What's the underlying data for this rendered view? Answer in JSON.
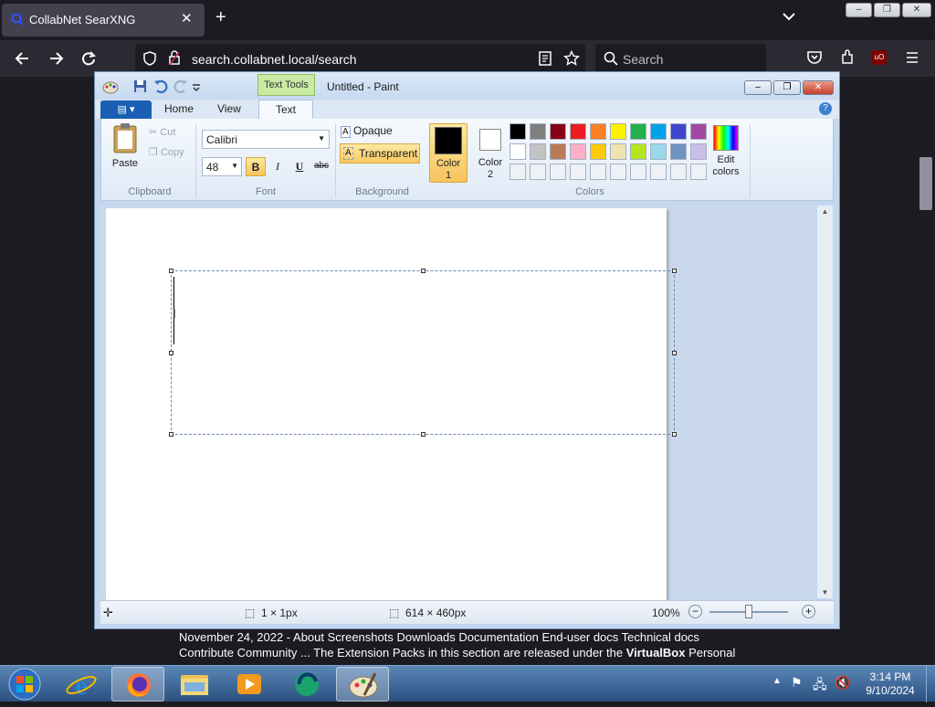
{
  "browser": {
    "tab_title": "CollabNet SearXNG",
    "url": "search.collabnet.local/search",
    "search_placeholder": "Search",
    "close_tab": "✕",
    "new_tab": "+",
    "list_all_tabs": "⌄"
  },
  "window_controls": {
    "minimize": "‒",
    "restore": "❐",
    "close": "✕"
  },
  "paint": {
    "title": "Untitled - Paint",
    "context_tab": "Text Tools",
    "tabs": [
      "Home",
      "View",
      "Text"
    ],
    "active_tab": "Text",
    "clipboard": {
      "paste": "Paste",
      "cut": "Cut",
      "copy": "Copy",
      "group_label": "Clipboard"
    },
    "font": {
      "family": "Calibri",
      "size": "48",
      "bold": "B",
      "italic": "I",
      "underline": "U",
      "strikethrough": "abc",
      "group_label": "Font"
    },
    "background": {
      "opaque": "Opaque",
      "transparent": "Transparent",
      "group_label": "Background"
    },
    "colors": {
      "color1_label": "Color",
      "color1_num": "1",
      "color2_label": "Color",
      "color2_num": "2",
      "color1": "#000000",
      "color2": "#ffffff",
      "edit_label": "Edit",
      "edit_label2": "colors",
      "group_label": "Colors",
      "palette_row1": [
        "#000000",
        "#7f7f7f",
        "#880015",
        "#ed1c24",
        "#ff7f27",
        "#fff200",
        "#22b14c",
        "#00a2e8",
        "#3f48cc",
        "#a349a4"
      ],
      "palette_row2": [
        "#ffffff",
        "#c3c3c3",
        "#b97a57",
        "#ffaec9",
        "#ffc90e",
        "#efe4b0",
        "#b5e61d",
        "#99d9ea",
        "#7092be",
        "#c8bfe7"
      ],
      "palette_row3": [
        "#eef1f5",
        "#eef1f5",
        "#eef1f5",
        "#eef1f5",
        "#eef1f5",
        "#eef1f5",
        "#eef1f5",
        "#eef1f5",
        "#eef1f5",
        "#eef1f5"
      ]
    },
    "status": {
      "selection_size": "1 × 1px",
      "canvas_size": "614 × 460px",
      "zoom": "100%"
    }
  },
  "web_snippet": {
    "line1": "November 24, 2022 - About Screenshots Downloads Documentation End-user docs Technical docs",
    "line2_pre": "Contribute Community ... The Extension Packs in this section are released under the ",
    "line2_bold": "VirtualBox",
    "line2_post": " Personal"
  },
  "taskbar": {
    "time": "3:14 PM",
    "date": "9/10/2024",
    "apps": [
      "internet-explorer",
      "firefox",
      "file-explorer",
      "media-player",
      "app-green",
      "paint"
    ]
  }
}
